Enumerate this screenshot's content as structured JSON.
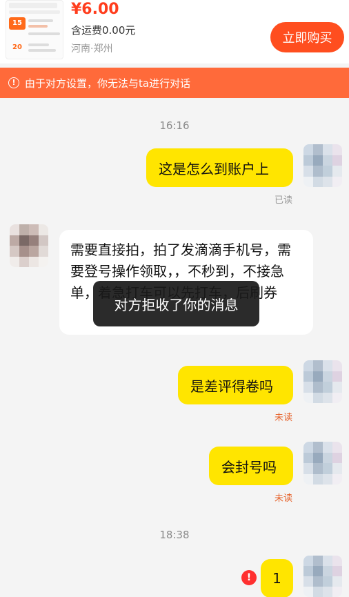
{
  "product": {
    "price": "¥6.00",
    "shipping": "含运费0.00元",
    "location": "河南·郑州",
    "buy_label": "立即购买",
    "thumb_badge_1": "15",
    "thumb_badge_2": "20"
  },
  "banner": {
    "icon": "!",
    "text": "由于对方设置，你无法与ta进行对话"
  },
  "chat": {
    "time_1": "16:16",
    "msg_1": "这是怎么到账户上",
    "msg_1_status": "已读",
    "msg_2": "需要直接拍，拍了发滴滴手机号，需要登号操作领取，，不秒到，不接急单，着急打车可以先打车，后刷券",
    "toast": "对方拒收了你的消息",
    "msg_3": "是差评得卷吗",
    "msg_3_status": "未读",
    "msg_4": "会封号吗",
    "msg_4_status": "未读",
    "time_2": "18:38",
    "msg_5": "1",
    "error_icon": "!"
  },
  "colors": {
    "accent": "#ff4e1f",
    "banner": "#ff6a3a",
    "bubble_self": "#ffe500",
    "bubble_other": "#ffffff",
    "unread": "#e6622b"
  }
}
